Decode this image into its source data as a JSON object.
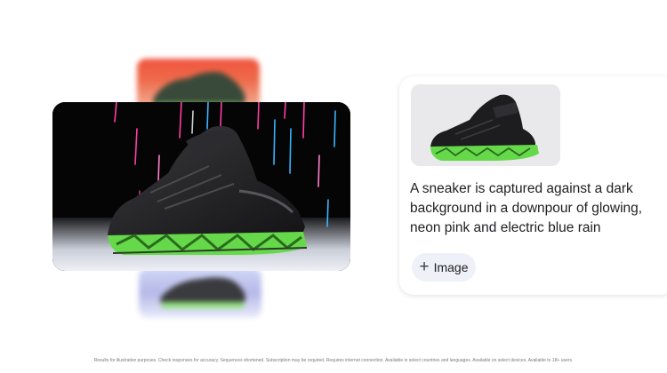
{
  "prompt_card": {
    "prompt_text": "A sneaker is captured against a dark background in a downpour of glowing, neon pink and electric blue rain",
    "image_button_label": "Image",
    "image_button_icon": "plus-icon"
  },
  "images": {
    "main_alt": "sneaker-rain-image",
    "thumb_alt": "reference-sneaker-image"
  },
  "colors": {
    "neon_green": "#66d94a",
    "neon_pink": "#ff3fa4",
    "electric_blue": "#3ab4ff",
    "chip_background": "#eef1f8"
  },
  "footer": {
    "disclaimer": "Results for illustrative purposes. Check responses for accuracy. Sequences shortened. Subscription may be required. Requires internet connection. Available in select countries and languages. Available on select devices. Available to 18+ users."
  }
}
